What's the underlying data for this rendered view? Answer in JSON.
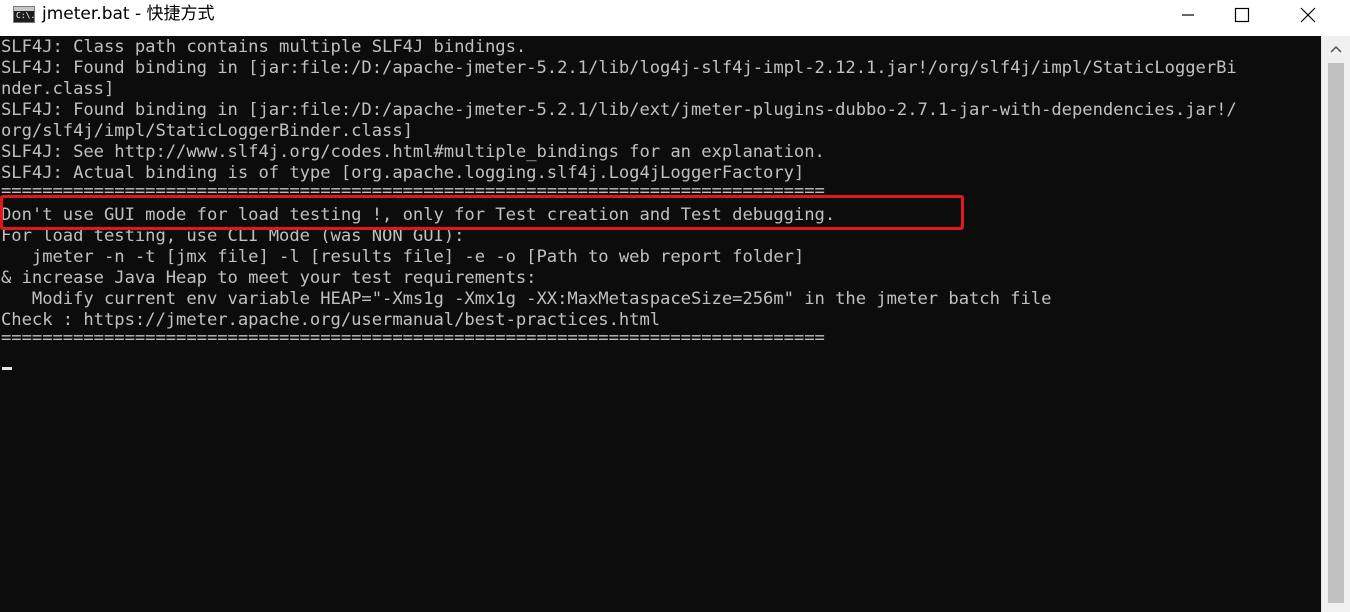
{
  "window": {
    "title": "jmeter.bat - 快捷方式",
    "icon": "cmd-icon",
    "icon_glyph": "C:\\.",
    "controls": {
      "minimize": "minimize-icon",
      "maximize": "maximize-icon",
      "close": "close-icon"
    }
  },
  "console": {
    "lines": [
      "SLF4J: Class path contains multiple SLF4J bindings.",
      "SLF4J: Found binding in [jar:file:/D:/apache-jmeter-5.2.1/lib/log4j-slf4j-impl-2.12.1.jar!/org/slf4j/impl/StaticLoggerBi",
      "nder.class]",
      "SLF4J: Found binding in [jar:file:/D:/apache-jmeter-5.2.1/lib/ext/jmeter-plugins-dubbo-2.7.1-jar-with-dependencies.jar!/",
      "org/slf4j/impl/StaticLoggerBinder.class]",
      "SLF4J: See http://www.slf4j.org/codes.html#multiple_bindings for an explanation.",
      "SLF4J: Actual binding is of type [org.apache.logging.slf4j.Log4jLoggerFactory]",
      "================================================================================",
      "Don't use GUI mode for load testing !, only for Test creation and Test debugging.",
      "For load testing, use CLI Mode (was NON GUI):",
      "   jmeter -n -t [jmx file] -l [results file] -e -o [Path to web report folder]",
      "& increase Java Heap to meet your test requirements:",
      "   Modify current env variable HEAP=\"-Xms1g -Xmx1g -XX:MaxMetaspaceSize=256m\" in the jmeter batch file",
      "Check : https://jmeter.apache.org/usermanual/best-practices.html",
      "================================================================================"
    ],
    "highlight_color": "#e0181b",
    "text_color": "#c0c0c0",
    "background": "#0c0c0c"
  },
  "scrollbar": {
    "up_icon": "chevron-up-icon"
  }
}
